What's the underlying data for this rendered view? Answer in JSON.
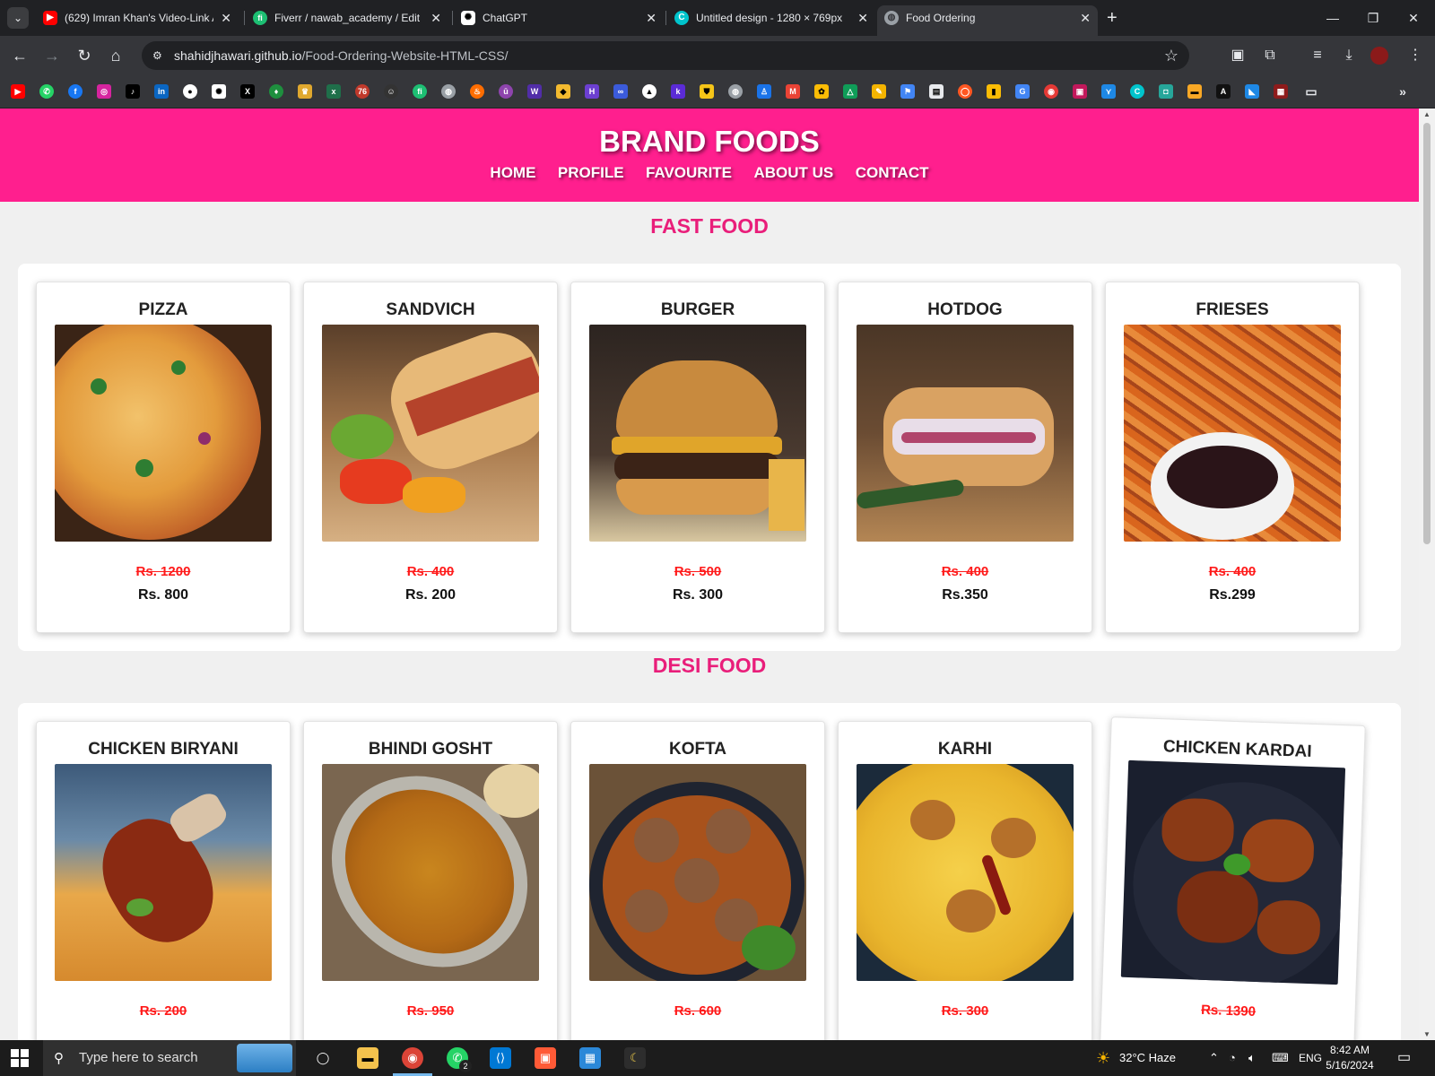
{
  "browser": {
    "tabs": [
      {
        "title": "(629) Imran Khan's Video-Link A",
        "icon": "youtube-icon",
        "color": "#ff0000",
        "glyph": "▶"
      },
      {
        "title": "Fiverr / nawab_academy / Edit G",
        "icon": "fiverr-icon",
        "color": "#1dbf73",
        "glyph": "fi"
      },
      {
        "title": "ChatGPT",
        "icon": "chatgpt-icon",
        "color": "#ffffff",
        "glyph": "✺"
      },
      {
        "title": "Untitled design - 1280 × 769px",
        "icon": "canva-icon",
        "color": "#00c4cc",
        "glyph": "C"
      },
      {
        "title": "Food Ordering",
        "icon": "globe-icon",
        "color": "#9aa0a6",
        "glyph": "◍"
      }
    ],
    "url_host": "shahidjhawari.github.io",
    "url_path": "/Food-Ordering-Website-HTML-CSS/"
  },
  "site": {
    "brand": "BRAND FOODS",
    "nav": [
      "HOME",
      "PROFILE",
      "FAVOURITE",
      "ABOUT US",
      "CONTACT"
    ],
    "colors": {
      "header": "#ff1f8e",
      "section_title": "#e91e7a",
      "old_price": "#ff1a1a"
    },
    "sections": [
      {
        "title": "FAST FOOD",
        "items": [
          {
            "name": "PIZZA",
            "old_price": "Rs. 1200",
            "new_price": "Rs. 800"
          },
          {
            "name": "SANDVICH",
            "old_price": "Rs. 400",
            "new_price": "Rs. 200"
          },
          {
            "name": "BURGER",
            "old_price": "Rs. 500",
            "new_price": "Rs. 300"
          },
          {
            "name": "HOTDOG",
            "old_price": "Rs. 400",
            "new_price": "Rs.350"
          },
          {
            "name": "FRIESES",
            "old_price": "Rs. 400",
            "new_price": "Rs.299"
          }
        ]
      },
      {
        "title": "DESI FOOD",
        "items": [
          {
            "name": "CHICKEN BIRYANI",
            "old_price": "Rs. 200",
            "new_price": ""
          },
          {
            "name": "BHINDI GOSHT",
            "old_price": "Rs. 950",
            "new_price": ""
          },
          {
            "name": "KOFTA",
            "old_price": "Rs. 600",
            "new_price": ""
          },
          {
            "name": "KARHI",
            "old_price": "Rs. 300",
            "new_price": ""
          },
          {
            "name": "CHICKEN KARDAI",
            "old_price": "Rs. 1390",
            "new_price": ""
          }
        ]
      }
    ]
  },
  "taskbar": {
    "search_placeholder": "Type here to search",
    "weather": "32°C  Haze",
    "language": "ENG",
    "time": "8:42 AM",
    "date": "5/16/2024",
    "whatsapp_badge": "2"
  }
}
